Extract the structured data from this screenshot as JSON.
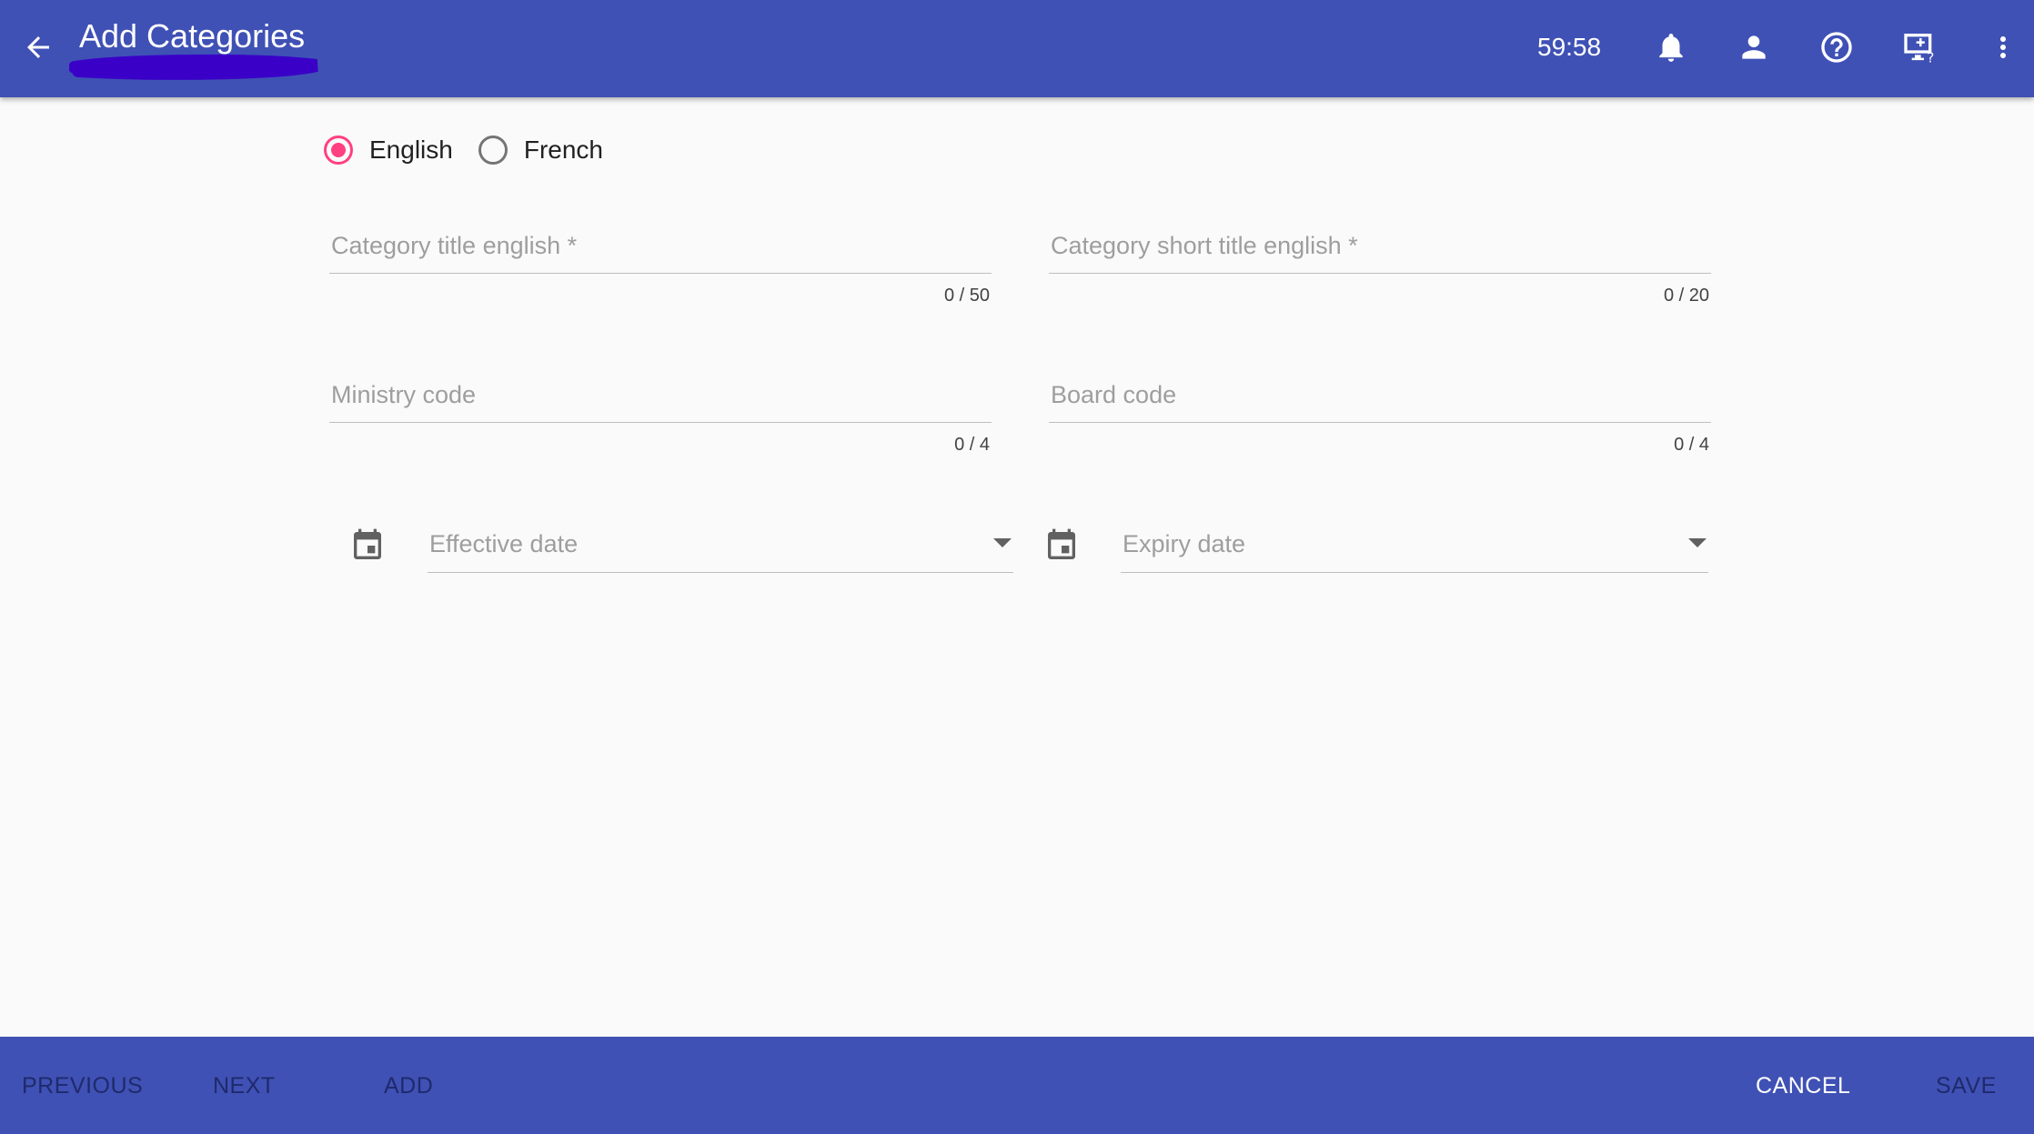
{
  "header": {
    "title": "Add Categories",
    "timer": "59:58",
    "icons": [
      "back-arrow-icon",
      "bell-icon",
      "person-icon",
      "help-circle-icon",
      "screen-help-icon",
      "more-vert-icon"
    ]
  },
  "language": {
    "options": [
      {
        "label": "English",
        "checked": true
      },
      {
        "label": "French",
        "checked": false
      }
    ]
  },
  "form": {
    "title_en": {
      "placeholder": "Category title english *",
      "counter": "0 / 50"
    },
    "short_title_en": {
      "placeholder": "Category short title english *",
      "counter": "0 / 20"
    },
    "ministry_code": {
      "placeholder": "Ministry code",
      "counter": "0 / 4"
    },
    "board_code": {
      "placeholder": "Board code",
      "counter": "0 / 4"
    },
    "effective_date": {
      "placeholder": "Effective date"
    },
    "expiry_date": {
      "placeholder": "Expiry date"
    }
  },
  "footer": {
    "previous": "PREVIOUS",
    "next": "NEXT",
    "add": "ADD",
    "cancel": "CANCEL",
    "save": "SAVE"
  },
  "colors": {
    "primary": "#3f51b5",
    "accent": "#ff4081",
    "scribble": "#3a00c8"
  }
}
